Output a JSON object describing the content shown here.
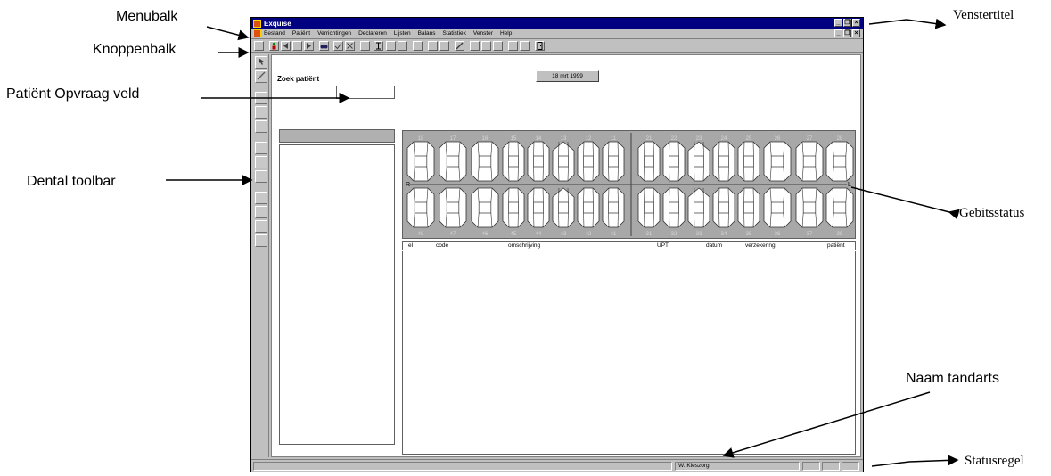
{
  "annotations": {
    "menubalk": "Menubalk",
    "knoppenbalk": "Knoppenbalk",
    "patient_opvraag_veld": "Patiënt Opvraag veld",
    "dental_toolbar": "Dental toolbar",
    "venstertitel": "Venstertitel",
    "gebitsstatus": "Gebitsstatus",
    "naam_tandarts": "Naam tandarts",
    "statusregel": "Statusregel"
  },
  "window": {
    "title": "Exquise",
    "controls": [
      "_",
      "❐",
      "×"
    ]
  },
  "menu": [
    {
      "label": "Bestand"
    },
    {
      "label": "Patiënt"
    },
    {
      "label": "Verrichtingen"
    },
    {
      "label": "Declareren"
    },
    {
      "label": "Lijsten"
    },
    {
      "label": "Balans"
    },
    {
      "label": "Statistiek"
    },
    {
      "label": "Venster"
    },
    {
      "label": "Help"
    }
  ],
  "search": {
    "label": "Zoek patiënt",
    "value": ""
  },
  "date_button": {
    "label": "18 mrt 1999"
  },
  "dental_chart": {
    "upper_numbers": [
      "18",
      "17",
      "16",
      "15",
      "14",
      "13",
      "12",
      "11",
      "21",
      "22",
      "23",
      "24",
      "25",
      "26",
      "27",
      "28"
    ],
    "lower_numbers": [
      "48",
      "47",
      "46",
      "45",
      "44",
      "43",
      "42",
      "41",
      "31",
      "32",
      "33",
      "34",
      "35",
      "36",
      "37",
      "38"
    ],
    "right_label": "R",
    "left_label": "L"
  },
  "treatment_table": {
    "columns": [
      "el",
      "code",
      "omschrijving",
      "UPT",
      "datum",
      "verzekering",
      "patiënt"
    ],
    "rows": []
  },
  "status": {
    "dentist_name": "W. Kieszorg"
  }
}
